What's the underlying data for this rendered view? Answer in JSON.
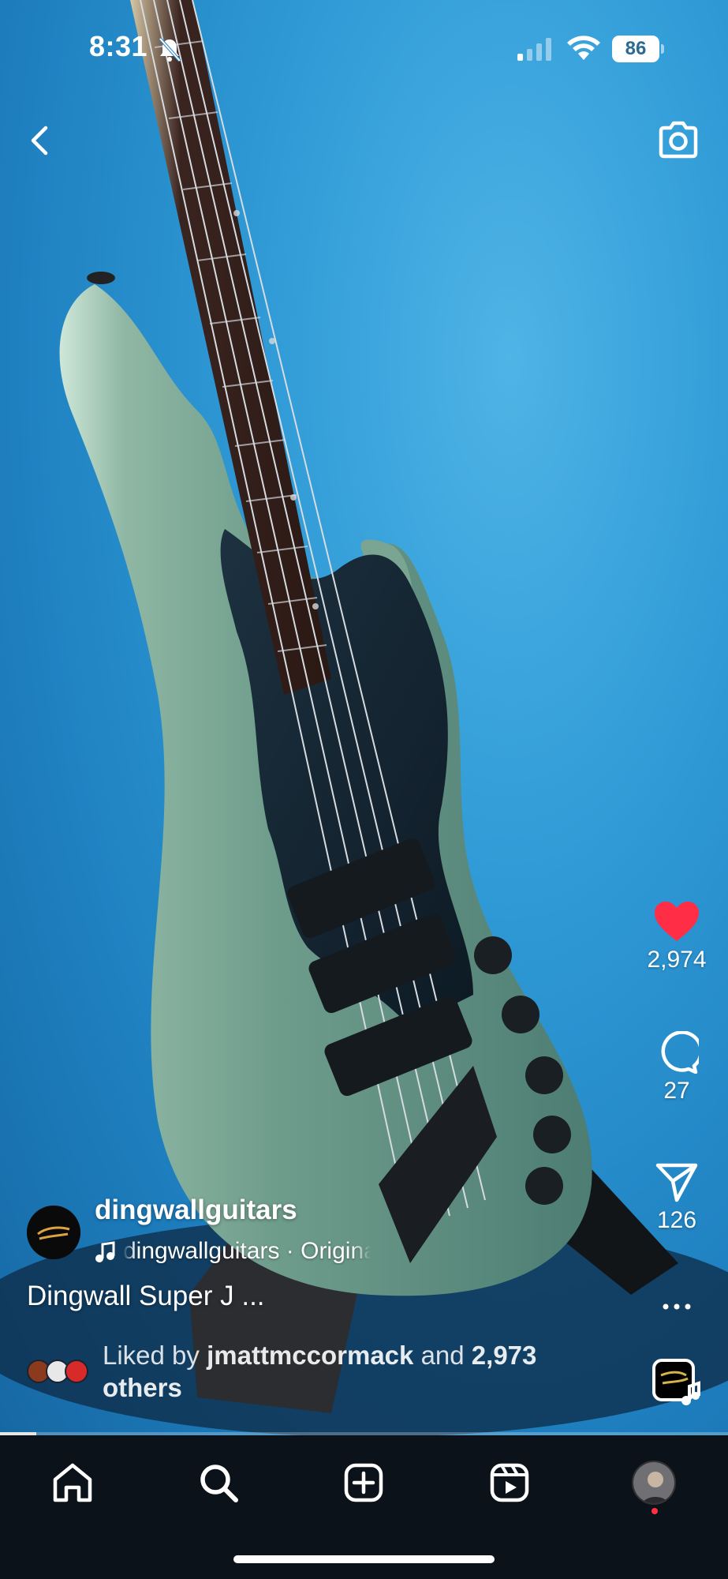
{
  "status_bar": {
    "time": "8:31",
    "battery": "86"
  },
  "post": {
    "username": "dingwallguitars",
    "audio": "dingwallguitars · Original audio",
    "caption": "Dingwall Super J ...",
    "liked_by_prefix": "Liked by",
    "liked_by_user": "jmattmccormack",
    "liked_by_and": "and",
    "liked_by_count": "2,973",
    "liked_by_suffix": "others"
  },
  "actions": {
    "likes": "2,974",
    "comments": "27",
    "shares": "126",
    "more": "..."
  },
  "progress": {
    "fraction": 0.05
  },
  "colors": {
    "like_heart": "#ff2d46",
    "accent_dot": "#ff3040"
  },
  "icons": [
    "bell-slash-icon",
    "signal-icon",
    "wifi-icon",
    "back-chevron-icon",
    "camera-icon",
    "heart-icon",
    "comment-icon",
    "share-icon",
    "more-icon",
    "audio-icon",
    "home-icon",
    "search-icon",
    "create-icon",
    "reels-icon"
  ]
}
